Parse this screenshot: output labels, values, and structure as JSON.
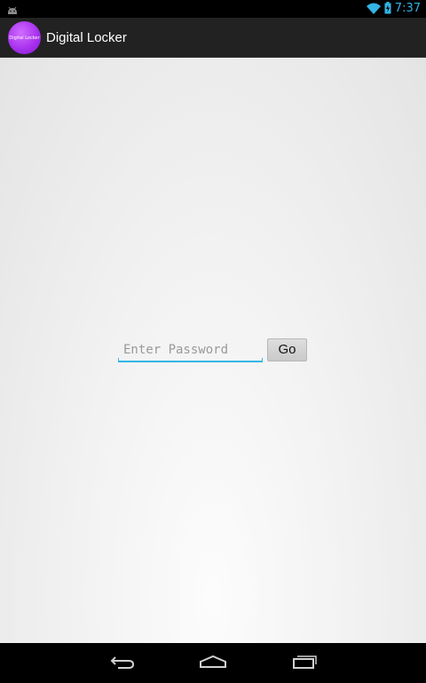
{
  "status_bar": {
    "time": "7:37",
    "left_icon": "android-debug-icon",
    "right_icons": [
      "wifi-icon",
      "battery-charging-icon"
    ],
    "accent_color": "#33b5e5"
  },
  "action_bar": {
    "title": "Digital Locker",
    "logo_text": "Digital Locker",
    "logo_color": "#a932ef"
  },
  "form": {
    "password_placeholder": "Enter Password",
    "password_value": "",
    "go_label": "Go"
  },
  "nav_bar": {
    "buttons": [
      "back-icon",
      "home-icon",
      "recent-apps-icon"
    ]
  }
}
